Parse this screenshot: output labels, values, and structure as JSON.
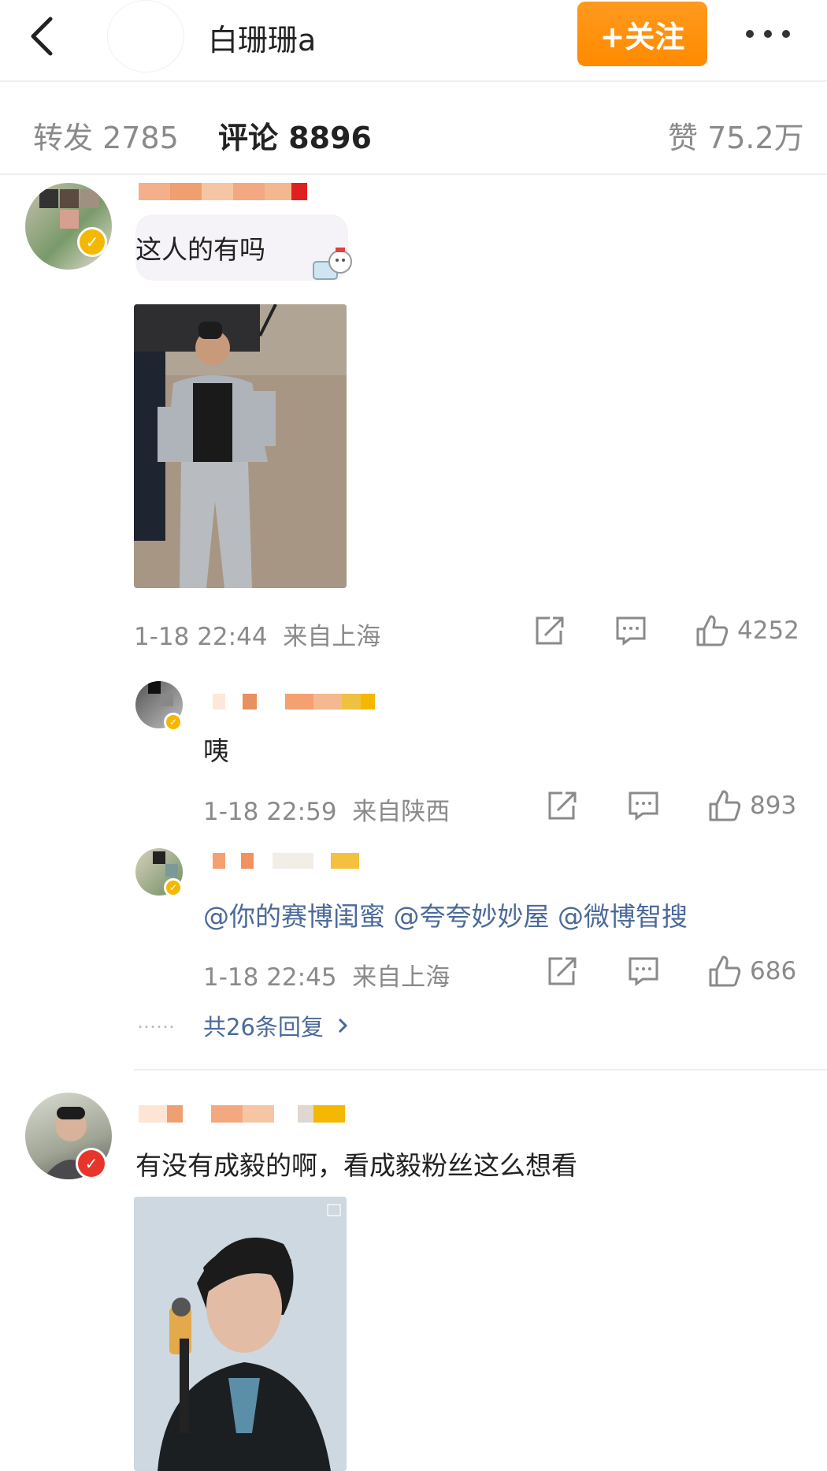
{
  "header": {
    "title": "白珊珊a",
    "follow_label": "+关注"
  },
  "tabs": {
    "repost": "转发 2785",
    "comment": "评论 8896",
    "like": "赞 75.2万"
  },
  "comments": [
    {
      "text": "这人的有吗",
      "time": "1-18 22:44",
      "location": "来自上海",
      "likes": "4252",
      "badge": "gold",
      "replies": [
        {
          "text": "咦",
          "time": "1-18 22:59",
          "location": "来自陕西",
          "likes": "893",
          "badge": "gold"
        },
        {
          "text": "@你的赛博闺蜜 @夸夸妙妙屋 @微博智搜",
          "time": "1-18 22:45",
          "location": "来自上海",
          "likes": "686",
          "badge": "gold"
        }
      ],
      "more_replies": "共26条回复",
      "more_prefix": "……"
    },
    {
      "text": "有没有成毅的啊，看成毅粉丝这么想看",
      "badge": "red"
    }
  ],
  "icons": [
    "back-arrow-icon",
    "more-dots-icon",
    "share-icon",
    "comment-icon",
    "like-icon",
    "chevron-right-icon",
    "verified-icon"
  ],
  "colors": {
    "accent": "#ff8a00",
    "mention": "#4a6a9a",
    "muted": "#8a8a8a"
  }
}
